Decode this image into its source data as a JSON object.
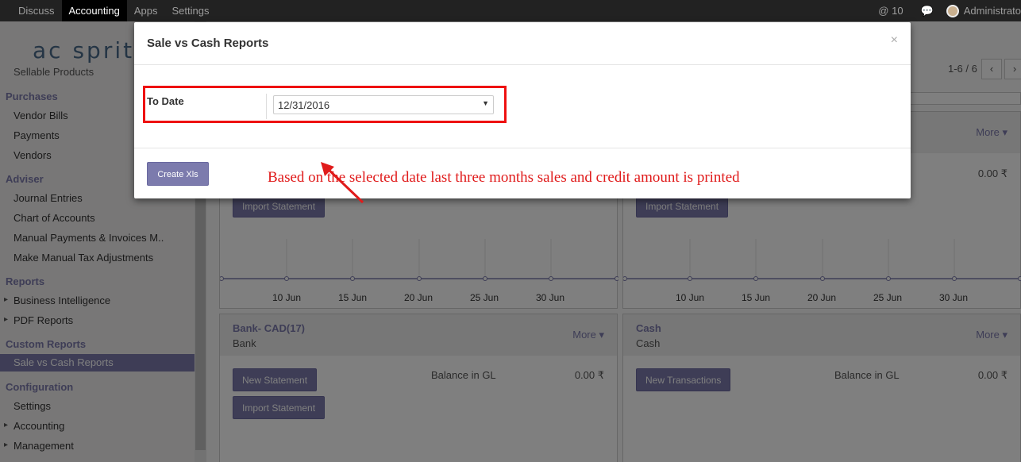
{
  "topbar": {
    "menu": [
      "Discuss",
      "Accounting",
      "Apps",
      "Settings"
    ],
    "active": "Accounting",
    "notif_count": "@ 10",
    "user": "Administrato"
  },
  "logo_text": "ac  sprit",
  "sidebar": {
    "partial_item": "Sellable Products",
    "sections": [
      {
        "heading": "Purchases",
        "items": [
          "Vendor Bills",
          "Payments",
          "Vendors"
        ]
      },
      {
        "heading": "Adviser",
        "items": [
          "Journal Entries",
          "Chart of Accounts",
          "Manual Payments & Invoices M..",
          "Make Manual Tax Adjustments"
        ]
      },
      {
        "heading": "Reports",
        "items": [
          "Business Intelligence",
          "PDF Reports"
        ]
      },
      {
        "heading": "Custom Reports",
        "items": [
          "Sale vs Cash Reports"
        ]
      },
      {
        "heading": "Configuration",
        "items": [
          "Settings",
          "Accounting",
          "Management"
        ]
      }
    ],
    "active_item": "Sale vs Cash Reports"
  },
  "pager": {
    "text": "1-6 / 6"
  },
  "cards": {
    "more_label": "More ▾",
    "import_label": "Import Statement",
    "new_statement_label": "New Statement",
    "new_transactions_label": "New Transactions",
    "balance_label": "Balance in GL",
    "balance_value": "0.00 ₹",
    "chart_ticks": [
      "10 Jun",
      "15 Jun",
      "20 Jun",
      "25 Jun",
      "30 Jun"
    ],
    "bank_title": "Bank- CAD(17)",
    "bank_sub": "Bank",
    "cash_title": "Cash",
    "cash_sub": "Cash"
  },
  "modal": {
    "title": "Sale vs Cash Reports",
    "close": "×",
    "field_label": "To Date",
    "date_value": "12/31/2016",
    "create_button": "Create Xls",
    "annotation": "Based on the selected date last three months sales and credit amount is printed"
  },
  "colors": {
    "accent": "#7c7bad",
    "annotation": "#ee1111",
    "topbar": "#222222"
  }
}
